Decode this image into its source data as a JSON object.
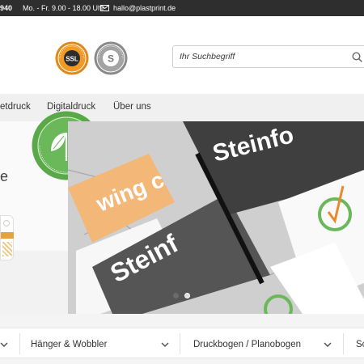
{
  "topbar": {
    "phone_fragment": "940",
    "hours": "Mo. - Fr. 9.00 - 18.00 Uhr",
    "email": "hallo@plastprint.de",
    "icon": "mail-icon"
  },
  "header": {
    "badges": [
      {
        "name": "ssl-seal",
        "text": "SSL"
      },
      {
        "name": "shop-seal",
        "text": "S"
      }
    ],
    "search": {
      "placeholder": "Ihr Suchbegriff",
      "icon": "search-icon"
    }
  },
  "nav": {
    "items": [
      {
        "label": "etdruck"
      },
      {
        "label": "Digitaldruck"
      },
      {
        "label": "Über uns"
      }
    ]
  },
  "hero": {
    "left_text": "e",
    "image_text": [
      "wing c",
      "Steinf",
      "Steinfo"
    ],
    "slider": {
      "total": 2,
      "active": 0
    },
    "colors": {
      "orange": "#e8a23b",
      "dark": "#4a4a4a",
      "green": "#5aa84a"
    }
  },
  "categories": {
    "items": [
      {
        "label": "Hänger & Wobbler"
      },
      {
        "label": "Druckbogen / Planobogen"
      },
      {
        "label": "Sc"
      }
    ]
  }
}
